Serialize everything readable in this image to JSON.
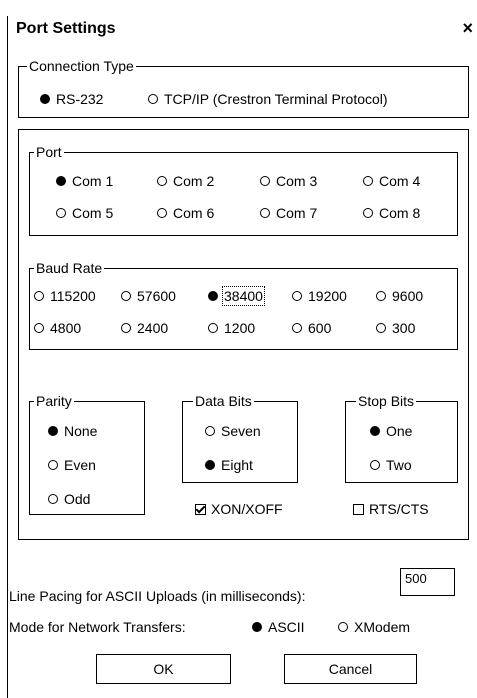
{
  "window": {
    "title": "Port Settings",
    "close": "×"
  },
  "connection_type": {
    "legend": "Connection Type",
    "options": [
      {
        "label": "RS-232",
        "selected": true
      },
      {
        "label": "TCP/IP (Crestron Terminal Protocol)",
        "selected": false
      }
    ]
  },
  "port": {
    "legend": "Port",
    "options": [
      {
        "label": "Com 1",
        "selected": true
      },
      {
        "label": "Com 2",
        "selected": false
      },
      {
        "label": "Com 3",
        "selected": false
      },
      {
        "label": "Com 4",
        "selected": false
      },
      {
        "label": "Com 5",
        "selected": false
      },
      {
        "label": "Com 6",
        "selected": false
      },
      {
        "label": "Com 7",
        "selected": false
      },
      {
        "label": "Com 8",
        "selected": false
      }
    ]
  },
  "baud_rate": {
    "legend": "Baud Rate",
    "options": [
      {
        "label": "115200",
        "selected": false
      },
      {
        "label": "57600",
        "selected": false
      },
      {
        "label": "38400",
        "selected": true
      },
      {
        "label": "19200",
        "selected": false
      },
      {
        "label": "9600",
        "selected": false
      },
      {
        "label": "4800",
        "selected": false
      },
      {
        "label": "2400",
        "selected": false
      },
      {
        "label": "1200",
        "selected": false
      },
      {
        "label": "600",
        "selected": false
      },
      {
        "label": "300",
        "selected": false
      }
    ]
  },
  "parity": {
    "legend": "Parity",
    "options": [
      {
        "label": "None",
        "selected": true
      },
      {
        "label": "Even",
        "selected": false
      },
      {
        "label": "Odd",
        "selected": false
      }
    ]
  },
  "data_bits": {
    "legend": "Data Bits",
    "options": [
      {
        "label": "Seven",
        "selected": false
      },
      {
        "label": "Eight",
        "selected": true
      }
    ]
  },
  "stop_bits": {
    "legend": "Stop Bits",
    "options": [
      {
        "label": "One",
        "selected": true
      },
      {
        "label": "Two",
        "selected": false
      }
    ]
  },
  "flow_control": {
    "xon_xoff": {
      "label": "XON/XOFF",
      "checked": true
    },
    "rts_cts": {
      "label": "RTS/CTS",
      "checked": false
    }
  },
  "line_pacing": {
    "label": "Line Pacing for ASCII Uploads (in milliseconds):",
    "value": "500"
  },
  "network_mode": {
    "label": "Mode for Network Transfers:",
    "options": [
      {
        "label": "ASCII",
        "selected": true
      },
      {
        "label": "XModem",
        "selected": false
      }
    ]
  },
  "buttons": {
    "ok": "OK",
    "cancel": "Cancel"
  }
}
